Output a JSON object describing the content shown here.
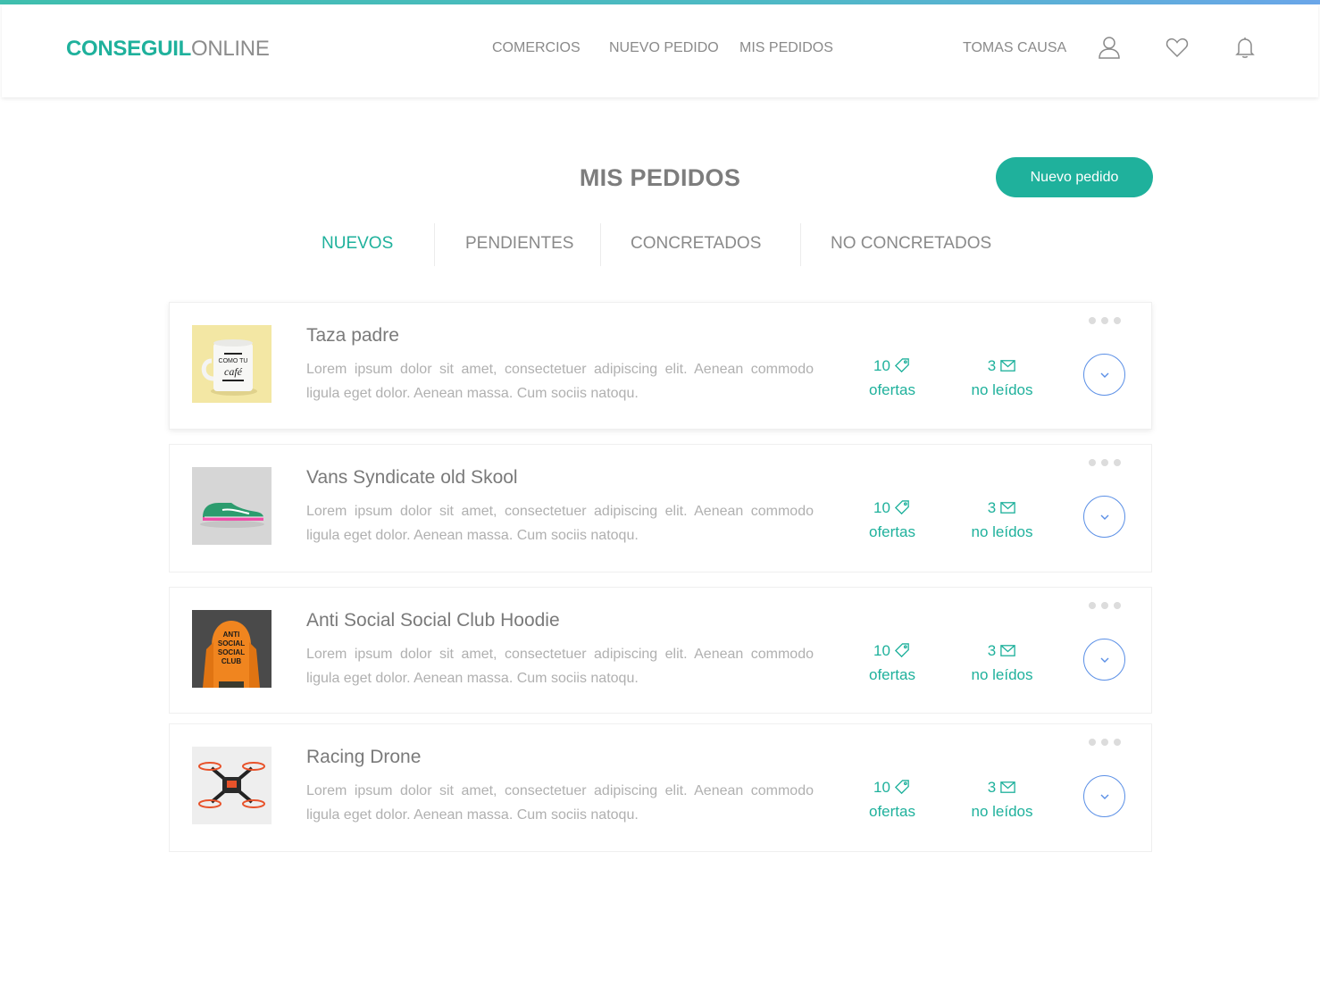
{
  "header": {
    "logo_part1": "CONSEGUIL",
    "logo_part2": "ONLINE",
    "nav": [
      {
        "label": "COMERCIOS"
      },
      {
        "label": "NUEVO PEDIDO"
      },
      {
        "label": "MIS PEDIDOS"
      }
    ],
    "user_name": "TOMAS CAUSA",
    "icons": [
      "user-icon",
      "heart-icon",
      "bell-icon"
    ]
  },
  "main": {
    "title": "MIS PEDIDOS",
    "new_button_label": "Nuevo pedido",
    "tabs": [
      {
        "label": "NUEVOS",
        "active": true
      },
      {
        "label": "PENDIENTES",
        "active": false
      },
      {
        "label": "CONCRETADOS",
        "active": false
      },
      {
        "label": "NO CONCRETADOS",
        "active": false
      }
    ],
    "orders": [
      {
        "name": "Taza padre",
        "description": "Lorem ipsum dolor sit amet, consectetuer adipiscing elit. Aenean commodo ligula eget dolor. Aenean massa. Cum sociis natoqu.",
        "offers_count": "10",
        "offers_label": "ofertas",
        "unread_count": "3",
        "unread_label": "no leídos",
        "image": "mug-photo"
      },
      {
        "name": "Vans Syndicate old Skool",
        "description": "Lorem ipsum dolor sit amet, consectetuer adipiscing elit. Aenean commodo ligula eget dolor. Aenean massa. Cum sociis natoqu.",
        "offers_count": "10",
        "offers_label": "ofertas",
        "unread_count": "3",
        "unread_label": "no leídos",
        "image": "sneaker-photo"
      },
      {
        "name": "Anti Social Social Club Hoodie",
        "description": "Lorem ipsum dolor sit amet, consectetuer adipiscing elit. Aenean commodo ligula eget dolor. Aenean massa. Cum sociis natoqu.",
        "offers_count": "10",
        "offers_label": "ofertas",
        "unread_count": "3",
        "unread_label": "no leídos",
        "image": "hoodie-photo"
      },
      {
        "name": "Racing Drone",
        "description": "Lorem ipsum dolor sit amet, consectetuer adipiscing elit. Aenean commodo ligula eget dolor. Aenean massa. Cum sociis natoqu.",
        "offers_count": "10",
        "offers_label": "ofertas",
        "unread_count": "3",
        "unread_label": "no leídos",
        "image": "drone-photo"
      }
    ]
  },
  "colors": {
    "accent": "#1fb19c",
    "expand_button": "#5a8fe6",
    "text_muted": "#b0b0b0"
  }
}
